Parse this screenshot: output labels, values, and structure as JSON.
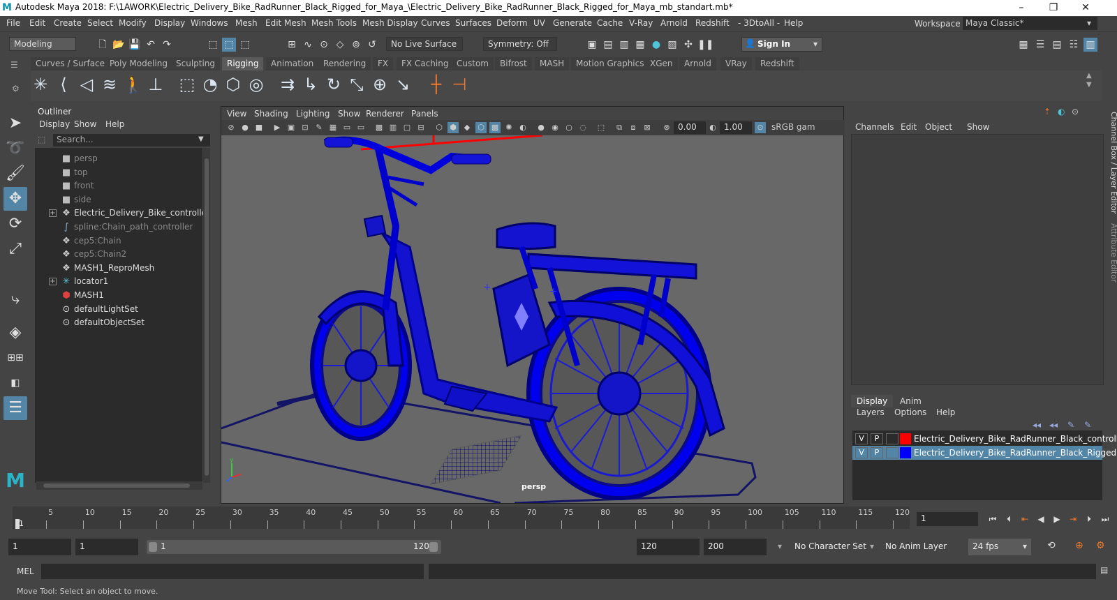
{
  "app": {
    "title": "Autodesk Maya 2018: F:\\1AWORK\\Electric_Delivery_Bike_RadRunner_Black_Rigged_for_Maya_\\Electric_Delivery_Bike_RadRunner_Black_Rigged_for_Maya_mb_standart.mb*",
    "logo": "M",
    "window_buttons": [
      "–",
      "❐",
      "✕"
    ]
  },
  "menu": [
    "File",
    "Edit",
    "Create",
    "Select",
    "Modify",
    "Display",
    "Windows",
    "Mesh",
    "Edit Mesh",
    "Mesh Tools",
    "Mesh Display",
    "Curves",
    "Surfaces",
    "Deform",
    "UV",
    "Generate",
    "Cache",
    "V-Ray",
    "Arnold",
    "Redshift",
    "- 3DtoAll -",
    "Help"
  ],
  "workspace": {
    "label": "Workspace :",
    "value": "Maya Classic*"
  },
  "status": {
    "mode": "Modeling",
    "live_surface": "No Live Surface",
    "symmetry": "Symmetry: Off",
    "sign_in": "Sign In"
  },
  "shelf_tabs": [
    "Curves / Surfaces",
    "Poly Modeling",
    "Sculpting",
    "Rigging",
    "Animation",
    "Rendering",
    "FX",
    "FX Caching",
    "Custom",
    "Bifrost",
    "MASH",
    "Motion Graphics",
    "XGen",
    "Arnold",
    "VRay",
    "Redshift"
  ],
  "shelf_active": "Rigging",
  "outliner": {
    "title": "Outliner",
    "menus": [
      "Display",
      "Show",
      "Help"
    ],
    "search_placeholder": "Search...",
    "items": [
      {
        "label": "persp",
        "icon": "camera-icon",
        "dim": true,
        "expand": false
      },
      {
        "label": "top",
        "icon": "camera-icon",
        "dim": true,
        "expand": false
      },
      {
        "label": "front",
        "icon": "camera-icon",
        "dim": true,
        "expand": false
      },
      {
        "label": "side",
        "icon": "camera-icon",
        "dim": true,
        "expand": false
      },
      {
        "label": "Electric_Delivery_Bike_controller",
        "icon": "transform-icon",
        "dim": false,
        "expand": true
      },
      {
        "label": "spline:Chain_path_controller",
        "icon": "curve-icon",
        "dim": true,
        "expand": false
      },
      {
        "label": "cep5:Chain",
        "icon": "transform-icon",
        "dim": true,
        "expand": false
      },
      {
        "label": "cep5:Chain2",
        "icon": "transform-icon",
        "dim": true,
        "expand": false
      },
      {
        "label": "MASH1_ReproMesh",
        "icon": "transform-icon",
        "dim": false,
        "expand": false
      },
      {
        "label": "locator1",
        "icon": "locator-icon",
        "dim": false,
        "expand": true
      },
      {
        "label": "MASH1",
        "icon": "mash-icon",
        "dim": false,
        "expand": false
      },
      {
        "label": "defaultLightSet",
        "icon": "set-icon",
        "dim": false,
        "expand": false
      },
      {
        "label": "defaultObjectSet",
        "icon": "set-icon",
        "dim": false,
        "expand": false
      }
    ]
  },
  "viewport": {
    "menus": [
      "View",
      "Shading",
      "Lighting",
      "Show",
      "Renderer",
      "Panels"
    ],
    "field_a": "0.00",
    "field_b": "1.00",
    "color_space": "sRGB gam",
    "camera": "persp"
  },
  "channel_box": {
    "menus": [
      "Channels",
      "Edit",
      "Object",
      "Show"
    ],
    "layer_tabs": [
      "Display",
      "Anim"
    ],
    "layer_menus": [
      "Layers",
      "Options",
      "Help"
    ],
    "layers": [
      {
        "v": "V",
        "p": "P",
        "color": "#ff0000",
        "name": "Electric_Delivery_Bike_RadRunner_Black_controllers",
        "selected": false
      },
      {
        "v": "V",
        "p": "P",
        "color": "#0000ff",
        "name": "Electric_Delivery_Bike_RadRunner_Black_Rigged",
        "selected": true
      }
    ],
    "side_tabs": [
      "Channel Box / Layer Editor",
      "Attribute Editor"
    ]
  },
  "timeline": {
    "ticks": [
      "1",
      "5",
      "10",
      "15",
      "20",
      "25",
      "30",
      "35",
      "40",
      "45",
      "50",
      "55",
      "60",
      "65",
      "70",
      "75",
      "80",
      "85",
      "90",
      "95",
      "100",
      "105",
      "110",
      "115",
      "120"
    ],
    "current_frame": "1"
  },
  "range": {
    "start": "1",
    "playback_start": "1",
    "slider_start": "1",
    "slider_end": "120",
    "playback_end": "120",
    "end": "200",
    "character_set": "No Character Set",
    "anim_layer": "No Anim Layer",
    "fps": "24 fps"
  },
  "command": {
    "label": "MEL"
  },
  "help_line": "Move Tool: Select an object to move."
}
